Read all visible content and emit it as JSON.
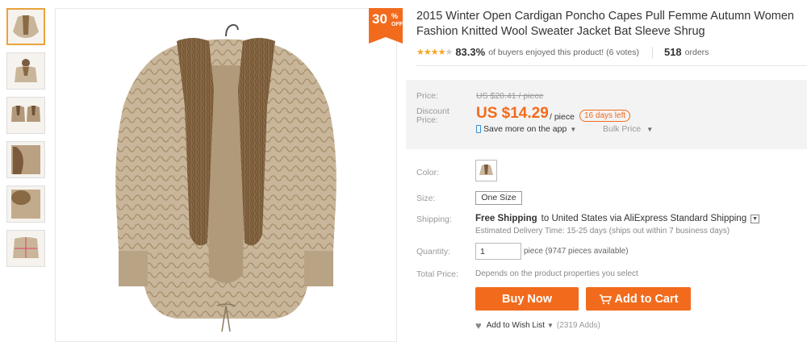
{
  "discount_badge": {
    "percent": "30",
    "percent_sign": "%",
    "off": "OFF"
  },
  "product": {
    "title_line1": "2015 Winter Open Cardigan Poncho Capes Pull Femme Autumn Women",
    "title_line2": "Fashion Knitted Wool Sweater Jacket Bat Sleeve Shrug"
  },
  "rating": {
    "stars": 4.5,
    "percent": "83.3%",
    "text": "of buyers enjoyed this product! (6 votes)",
    "orders_count": "518",
    "orders_label": "orders"
  },
  "price": {
    "price_label": "Price:",
    "original": "US $20.41 / piece",
    "discount_label": "Discount Price:",
    "current": "US $14.29",
    "per_piece": "/ piece",
    "days_left": "16 days left",
    "app_save": "Save more on the app",
    "bulk_price": "Bulk Price"
  },
  "options": {
    "color_label": "Color:",
    "size_label": "Size:",
    "size_value": "One Size",
    "shipping_label": "Shipping:",
    "shipping_free": "Free Shipping",
    "shipping_dest": "to  United States via AliExpress Standard Shipping",
    "delivery": "Estimated Delivery Time: 15-25 days (ships out within 7 business days)",
    "quantity_label": "Quantity:",
    "quantity_value": "1",
    "quantity_note": "piece (9747 pieces available)",
    "total_label": "Total Price:",
    "total_note": "Depends on the product properties you select"
  },
  "actions": {
    "buy_now": "Buy Now",
    "add_to_cart": "Add to Cart",
    "wish_list": "Add to Wish List",
    "wish_count": "(2319 Adds)"
  },
  "colors": {
    "accent": "#f26b1d",
    "star": "#f6a623",
    "fur": "#8a6a45",
    "knit": "#c9b69a"
  }
}
